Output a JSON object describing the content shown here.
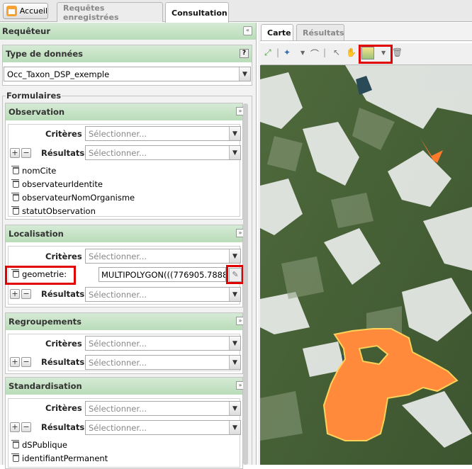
{
  "top_tabs": {
    "home": "Accueil",
    "saved": "Requêtes enregistrées",
    "consult": "Consultation"
  },
  "left": {
    "title": "Requêteur",
    "data_type": {
      "label": "Type de données",
      "help": "?",
      "value": "Occ_Taxon_DSP_exemple"
    },
    "forms_label": "Formulaires",
    "criteria_label": "Critères",
    "results_label": "Résultats",
    "select_placeholder": "Sélectionner...",
    "sections": [
      {
        "title": "Observation",
        "results": [
          "nomCite",
          "observateurIdentite",
          "observateurNomOrganisme",
          "statutObservation"
        ]
      },
      {
        "title": "Localisation",
        "criterion_name": "geometrie:",
        "criterion_value": "MULTIPOLYGON(((776905.7888"
      },
      {
        "title": "Regroupements"
      },
      {
        "title": "Standardisation",
        "results": [
          "dSPublique",
          "identifiantPermanent"
        ]
      }
    ]
  },
  "right": {
    "tabs": [
      "Carte",
      "Résultats"
    ]
  },
  "colors": {
    "highlight": "#e00000",
    "polygon_fill": "#ff8a3c",
    "polygon_stroke": "#ffd35a"
  },
  "icons": [
    "zoom-extent-icon",
    "draw-polygon-icon",
    "measure-icon",
    "select-arrow-icon",
    "pan-hand-icon",
    "map-layer-icon",
    "trash-icon"
  ]
}
